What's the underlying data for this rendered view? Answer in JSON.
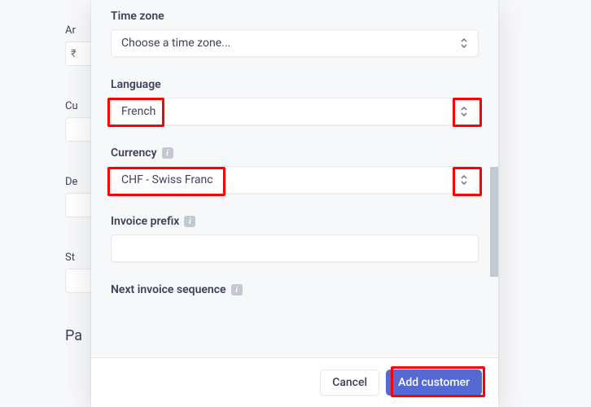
{
  "background": {
    "row1_label": "Ar",
    "row1_input": "₹",
    "row2_label": "Cu",
    "row3_label": "De",
    "row4_label": "St",
    "bottom_label": "Pa"
  },
  "form": {
    "timezone": {
      "label": "Time zone",
      "placeholder": "Choose a time zone..."
    },
    "language": {
      "label": "Language",
      "value": "French"
    },
    "currency": {
      "label": "Currency",
      "value": "CHF - Swiss Franc"
    },
    "invoice_prefix": {
      "label": "Invoice prefix",
      "value": ""
    },
    "next_sequence": {
      "label": "Next invoice sequence"
    }
  },
  "footer": {
    "cancel_label": "Cancel",
    "submit_label": "Add customer"
  }
}
